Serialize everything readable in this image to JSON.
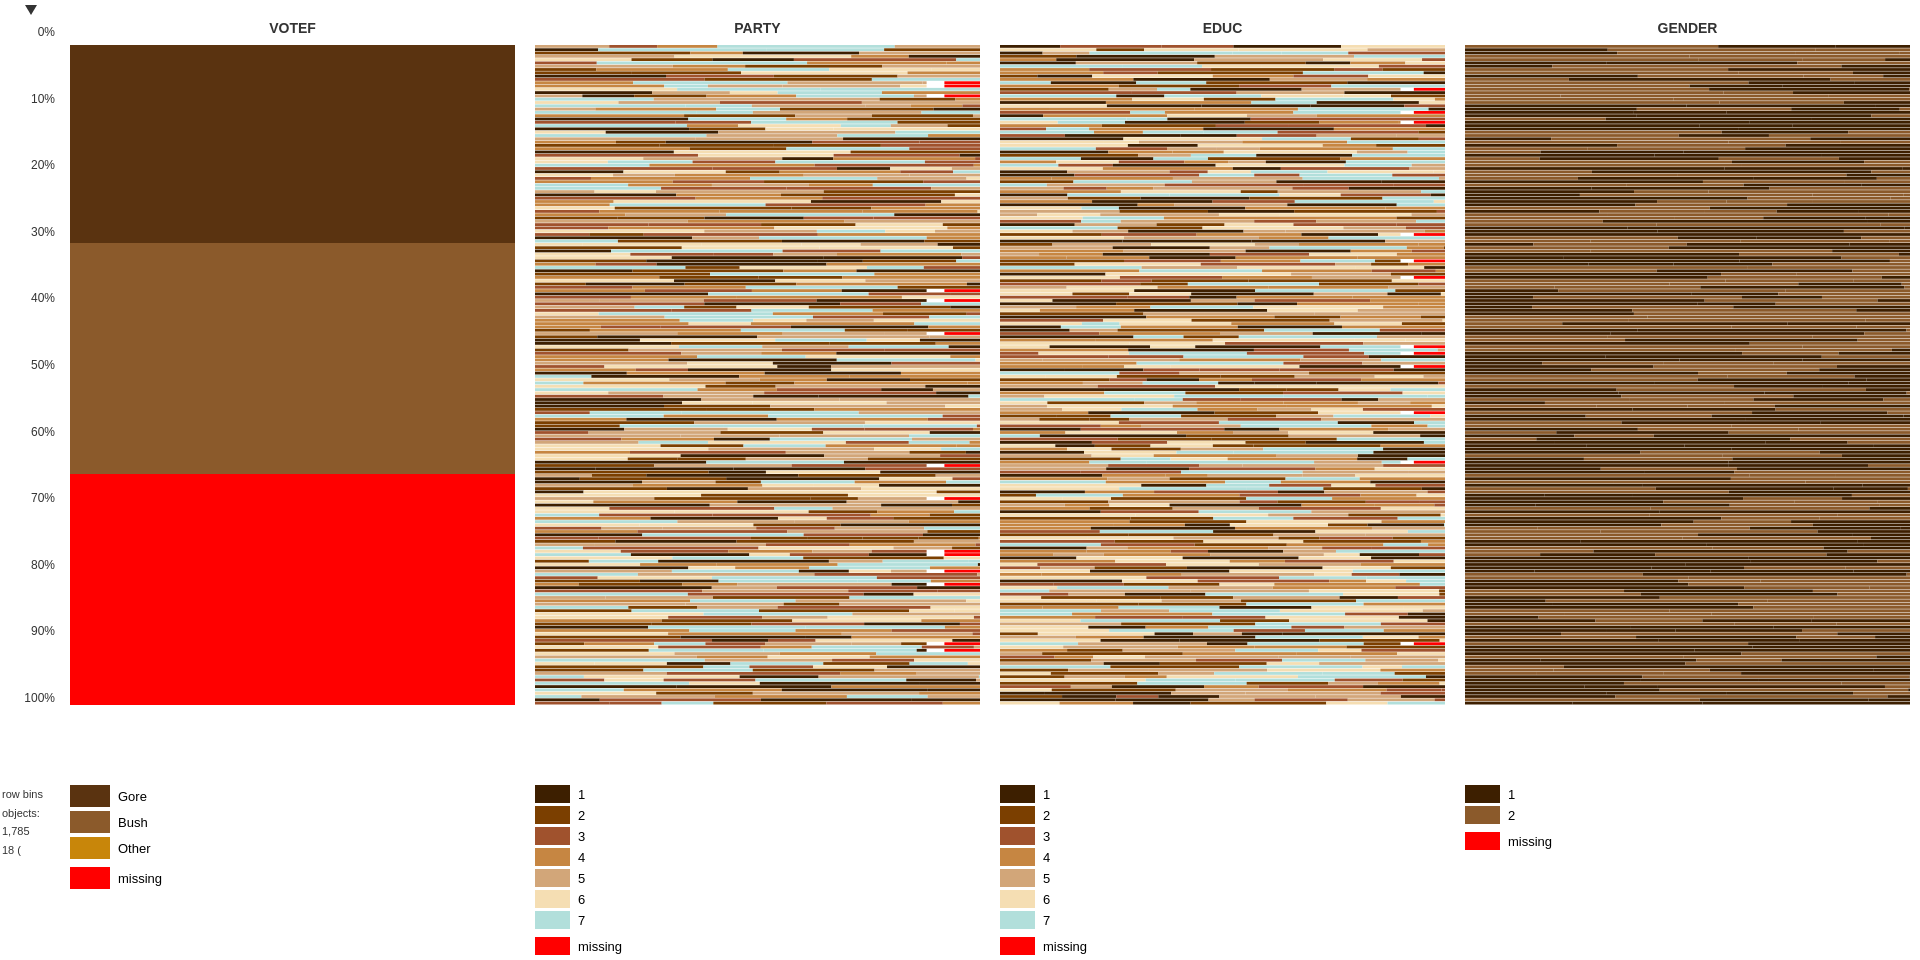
{
  "charts": {
    "titles": [
      "VOTEF",
      "PARTY",
      "EDUC",
      "GENDER"
    ],
    "yLabels": [
      "0%",
      "10%",
      "20%",
      "30%",
      "40%",
      "50%",
      "60%",
      "70%",
      "80%",
      "90%",
      "100%"
    ],
    "votef": {
      "segments": [
        {
          "color": "#5a3310",
          "heightPct": 30
        },
        {
          "color": "#8B5A2B",
          "heightPct": 35
        },
        {
          "color": "#ff0000",
          "heightPct": 35
        }
      ],
      "legend": [
        {
          "color": "#5a3310",
          "label": "Gore"
        },
        {
          "color": "#8B5A2B",
          "label": "Bush"
        },
        {
          "color": "#c8860a",
          "label": "Other"
        }
      ],
      "missingColor": "#ff0000",
      "missingLabel": "missing"
    },
    "party": {
      "colors": [
        "#3d1f00",
        "#7B3F00",
        "#A0522D",
        "#C68642",
        "#D2A679",
        "#F5DEB3",
        "#b2dfdb"
      ],
      "missingColor": "#ff0000",
      "legendLabels": [
        "1",
        "2",
        "3",
        "4",
        "5",
        "6",
        "7"
      ],
      "missingLabel": "missing"
    },
    "educ": {
      "colors": [
        "#3d1f00",
        "#7B3F00",
        "#A0522D",
        "#C68642",
        "#D2A679",
        "#F5DEB3",
        "#b2dfdb"
      ],
      "missingColor": "#ff0000",
      "legendLabels": [
        "1",
        "2",
        "3",
        "4",
        "5",
        "6",
        "7"
      ],
      "missingLabel": "missing"
    },
    "gender": {
      "colors": [
        "#3d1f00",
        "#8B5A2B"
      ],
      "missingColor": "#ff0000",
      "legendLabels": [
        "1",
        "2"
      ],
      "missingLabel": "missing"
    }
  },
  "leftInfo": {
    "rowBins": "row bins",
    "objects": "objects:",
    "count": "1,785",
    "missing": "18 ("
  }
}
